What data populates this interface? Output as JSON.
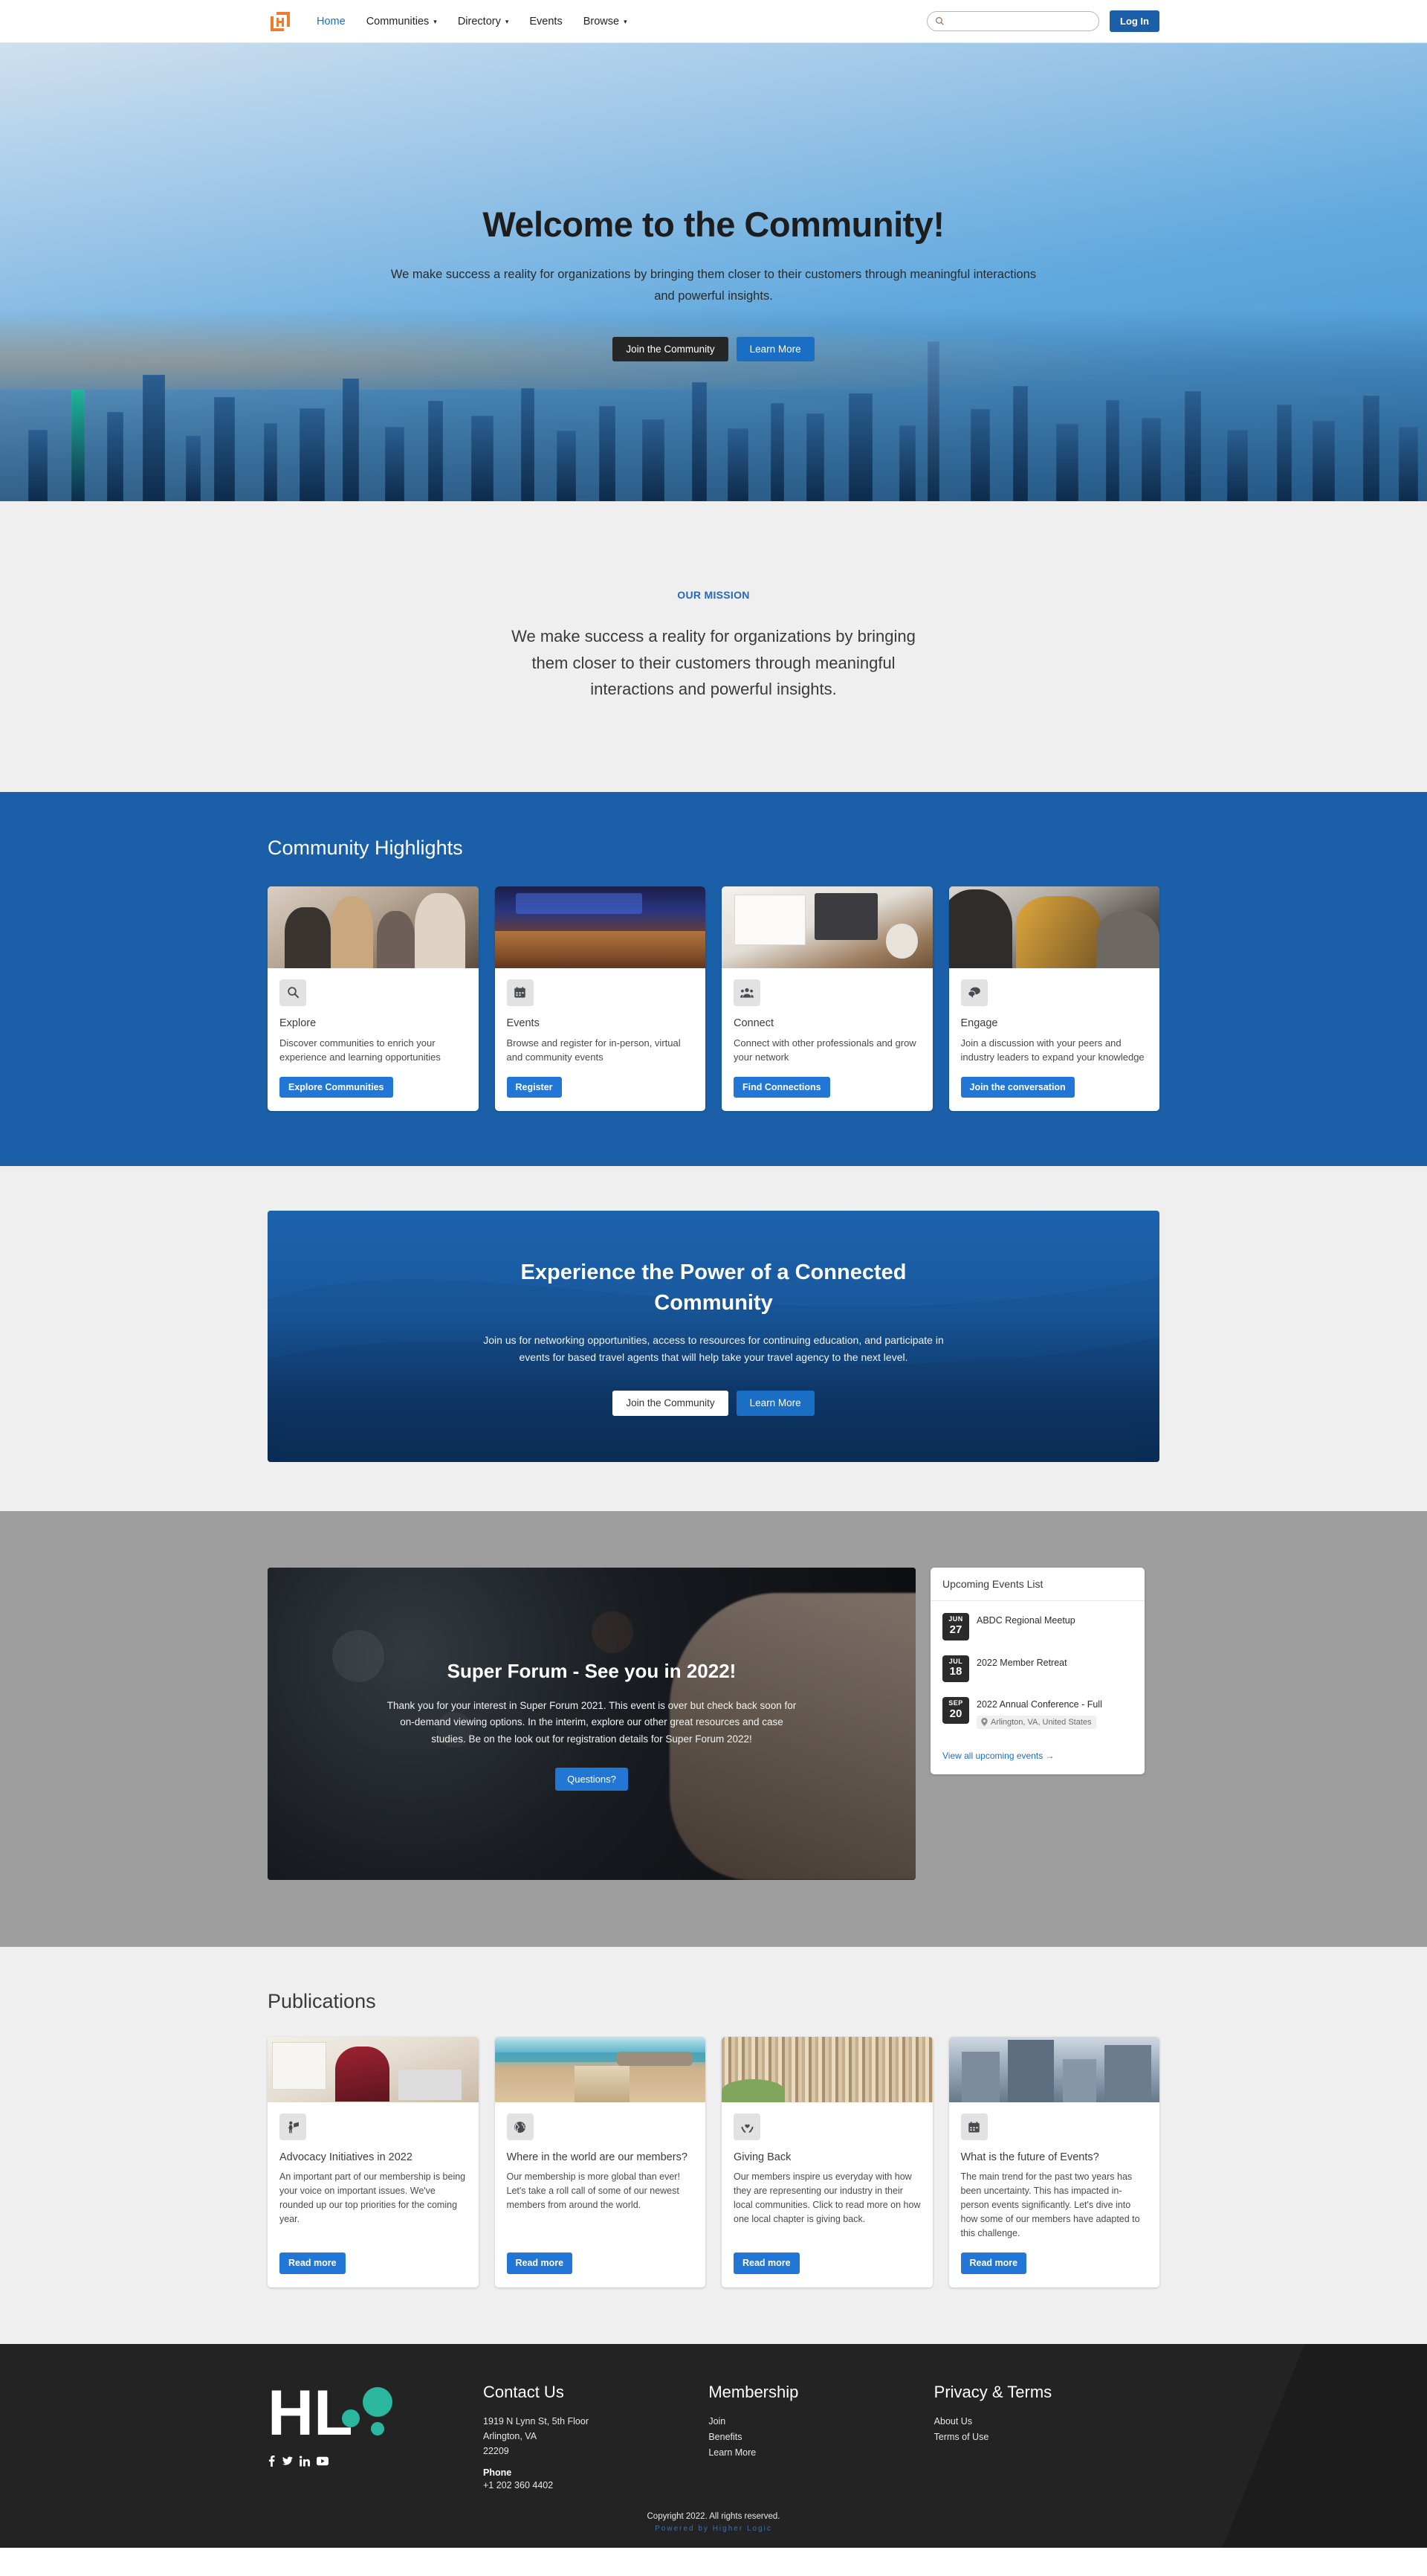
{
  "header": {
    "logo_icon": "higher-logic-logo-icon",
    "nav": [
      {
        "label": "Home",
        "has_caret": false,
        "active": true
      },
      {
        "label": "Communities",
        "has_caret": true,
        "active": false
      },
      {
        "label": "Directory",
        "has_caret": true,
        "active": false
      },
      {
        "label": "Events",
        "has_caret": false,
        "active": false
      },
      {
        "label": "Browse",
        "has_caret": true,
        "active": false
      }
    ],
    "search": {
      "placeholder": "",
      "value": "",
      "icon": "search-icon"
    },
    "login_label": "Log In"
  },
  "hero": {
    "title": "Welcome to the Community!",
    "subtitle": "We make success a reality for organizations by bringing them closer to their customers through meaningful interactions and powerful insights.",
    "primary_button": "Join the Community",
    "secondary_button": "Learn More"
  },
  "mission": {
    "eyebrow": "OUR MISSION",
    "text": "We make success a reality for organizations by bringing them closer to their customers through meaningful interactions and powerful insights."
  },
  "highlights": {
    "title": "Community Highlights",
    "cards": [
      {
        "icon": "search-icon",
        "title": "Explore",
        "desc": "Discover communities to enrich your experience and learning opportunities",
        "button": "Explore Communities"
      },
      {
        "icon": "calendar-icon",
        "title": "Events",
        "desc": "Browse and register for in-person, virtual and community events",
        "button": "Register"
      },
      {
        "icon": "users-icon",
        "title": "Connect",
        "desc": "Connect with other professionals and grow your network",
        "button": "Find Connections"
      },
      {
        "icon": "comments-icon",
        "title": "Engage",
        "desc": "Join a discussion with your peers and industry leaders to expand your knowledge",
        "button": "Join the conversation"
      }
    ]
  },
  "power_banner": {
    "title": "Experience the Power of a Connected Community",
    "subtitle": "Join us for networking opportunities, access to resources for continuing education, and participate in events for based travel agents that will help take your travel agency to the next level.",
    "primary_button": "Join the Community",
    "secondary_button": "Learn More"
  },
  "forum": {
    "title": "Super Forum - See you in 2022!",
    "text": "Thank you for your interest in Super Forum 2021. This event is over but check back soon for on-demand viewing options. In the interim, explore our other great resources and case studies. Be on the look out for registration details for Super Forum 2022!",
    "button": "Questions?"
  },
  "events_panel": {
    "title": "Upcoming Events List",
    "events": [
      {
        "month": "JUN",
        "day": "27",
        "name": "ABDC Regional Meetup",
        "location": ""
      },
      {
        "month": "JUL",
        "day": "18",
        "name": "2022 Member Retreat",
        "location": ""
      },
      {
        "month": "SEP",
        "day": "20",
        "name": "2022 Annual Conference - Full",
        "location": "Arlington, VA, United States"
      }
    ],
    "view_all_label": "View all upcoming events  →"
  },
  "publications": {
    "title": "Publications",
    "cards": [
      {
        "icon": "advocacy-icon",
        "title": "Advocacy Initiatives in 2022",
        "desc": "An important part of our membership is being your voice on important issues. We've rounded up our top priorities for the coming year.",
        "button": "Read more"
      },
      {
        "icon": "globe-icon",
        "title": "Where in the world are our members?",
        "desc": "Our membership is more global than ever! Let's take a roll call of some of our newest members from around the world.",
        "button": "Read more"
      },
      {
        "icon": "hands-heart-icon",
        "title": "Giving Back",
        "desc": "Our members inspire us everyday with how they are representing our industry in their local communities. Click to read more on how one local chapter is giving back.",
        "button": "Read more"
      },
      {
        "icon": "calendar-icon",
        "title": "What is the future of Events?",
        "desc": "The main trend for the past two years has been uncertainty. This has impacted in-person events significantly. Let's dive into how some of our members have adapted to this challenge.",
        "button": "Read more"
      }
    ]
  },
  "footer": {
    "logo_text": "HL",
    "social": [
      "facebook-icon",
      "twitter-icon",
      "linkedin-icon",
      "youtube-icon"
    ],
    "contact": {
      "heading": "Contact Us",
      "address_line1": "1919 N Lynn St, 5th Floor",
      "address_line2": "Arlington, VA",
      "address_line3": "22209",
      "phone_label": "Phone",
      "phone": "+1 202 360 4402"
    },
    "membership": {
      "heading": "Membership",
      "links": [
        "Join",
        "Benefits",
        "Learn More"
      ]
    },
    "privacy": {
      "heading": "Privacy & Terms",
      "links": [
        "About Us",
        "Terms of Use"
      ]
    },
    "copyright": "Copyright 2022. All rights reserved.",
    "powered_by": "Powered by Higher Logic"
  },
  "colors": {
    "brand_orange": "#ED7D31",
    "brand_blue": "#1a5fa8",
    "accent_blue": "#2276d6",
    "link_blue": "#1f6dc0",
    "teal": "#2bb6a0",
    "dark": "#232323"
  }
}
